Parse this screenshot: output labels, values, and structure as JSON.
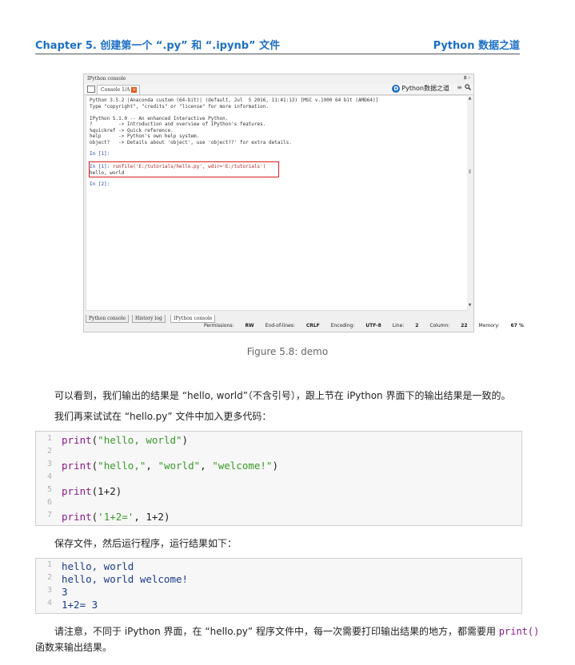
{
  "header": {
    "chapter": "Chapter 5.",
    "chapter_title": "创建第一个 “.py” 和 “.ipynb” 文件",
    "book_title": "Python 数据之道"
  },
  "screenshot": {
    "window_title": "IPython console",
    "window_buttons": "฿ ›",
    "tab_label": "Console 1/A",
    "tab_close": "×",
    "brand_logo": "D",
    "brand_text": "Python数据之道",
    "menu_icon": "≡",
    "search_icon": "⌕",
    "console_lines": [
      "Python 3.5.2 |Anaconda custom (64-bit)| (default, Jul  5 2016, 11:41:13) [MSC v.1900 64 bit (AMD64)]",
      "Type \"copyright\", \"credits\" or \"license\" for more information.",
      "",
      "IPython 5.1.0 -- An enhanced Interactive Python.",
      "?         -> Introduction and overview of IPython's features.",
      "%quickref -> Quick reference.",
      "help      -> Python's own help system.",
      "object?   -> Details about 'object', use 'object??' for extra details."
    ],
    "prompt1": "In [1]:",
    "run_prompt": "In [1]: ",
    "run_cmd": "runfile('E:/tutorials/hello.py', wdir='E:/tutorials')",
    "run_output": "hello, world",
    "prompt2": "In [2]:",
    "bottom_tabs": [
      "Python console",
      "History log",
      "IPython console"
    ],
    "status": {
      "permissions_label": "Permissions:",
      "permissions_value": "RW",
      "eol_label": "End-of-lines:",
      "eol_value": "CRLF",
      "encoding_label": "Encoding:",
      "encoding_value": "UTF-8",
      "line_label": "Line:",
      "line_value": "2",
      "column_label": "Column:",
      "column_value": "22",
      "memory_label": "Memory:",
      "memory_value": "67 %"
    }
  },
  "caption": "Figure 5.8: demo",
  "para1": "可以看到，我们输出的结果是 “hello, world”（不含引号），跟上节在 iPython 界面下的输出结果是一致的。",
  "para2": "我们再来试试在 “hello.py” 文件中加入更多代码：",
  "code1": {
    "line_numbers": [
      "1",
      "2",
      "3",
      "4",
      "5",
      "6",
      "7"
    ],
    "l1_kw": "print",
    "l1_rest_a": "(",
    "l1_str": "\"hello, world\"",
    "l1_rest_b": ")",
    "l3_kw": "print",
    "l3_a": "(",
    "l3_s1": "\"hello,\"",
    "l3_b": ", ",
    "l3_s2": "\"world\"",
    "l3_c": ", ",
    "l3_s3": "\"welcome!\"",
    "l3_d": ")",
    "l5_kw": "print",
    "l5_rest": "(1+2)",
    "l7_kw": "print",
    "l7_a": "(",
    "l7_str": "'1+2='",
    "l7_b": ", 1+2)"
  },
  "para3": "保存文件，然后运行程序，运行结果如下：",
  "code2": {
    "line_numbers": [
      "1",
      "2",
      "3",
      "4"
    ],
    "lines": [
      "hello, world",
      "hello, world welcome!",
      "3",
      "1+2= 3"
    ]
  },
  "para4_a": "请注意，不同于 iPython 界面，在 “hello.py” 程序文件中，每一次需要打印输出结果的地方，都需要用 ",
  "para4_code": "print()",
  "para4_b": "函数来输出结果。"
}
